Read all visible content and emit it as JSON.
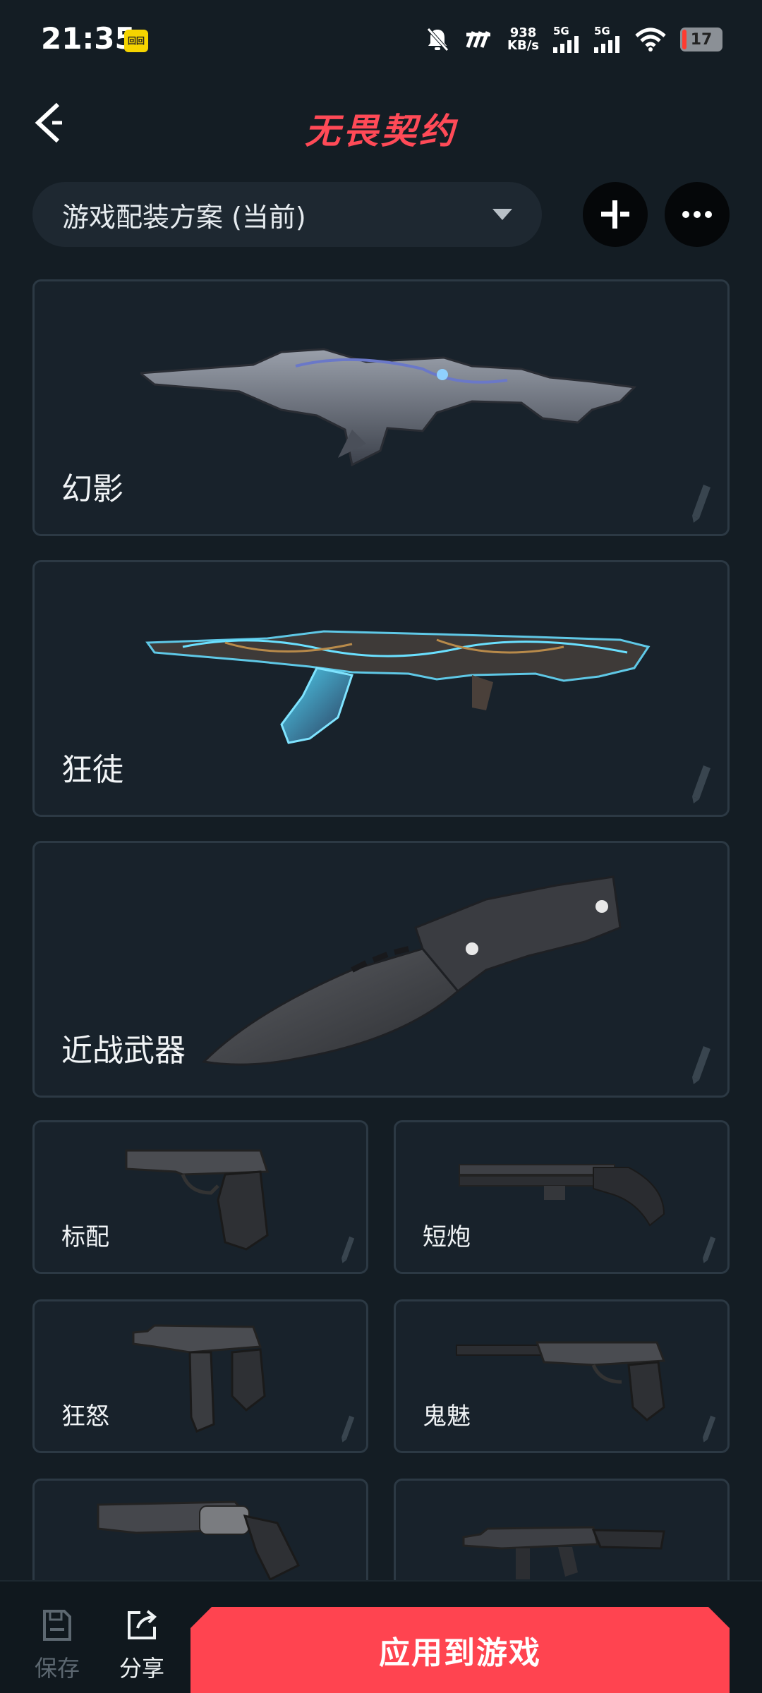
{
  "status_bar": {
    "time": "21:35",
    "notification_badge": "回回",
    "net_speed_value": "938",
    "net_speed_unit": "KB/s",
    "sim1_label": "5G",
    "sim2_label": "5G",
    "battery_level": "17"
  },
  "header": {
    "title": "无畏契约"
  },
  "loadout_selector": {
    "label": "游戏配装方案 (当前)"
  },
  "weapons": {
    "phantom": {
      "label": "幻影"
    },
    "vandal": {
      "label": "狂徒"
    },
    "melee": {
      "label": "近战武器"
    },
    "classic": {
      "label": "标配"
    },
    "shorty": {
      "label": "短炮"
    },
    "frenzy": {
      "label": "狂怒"
    },
    "ghost": {
      "label": "鬼魅"
    },
    "sheriff": {
      "label": ""
    },
    "stinger": {
      "label": ""
    }
  },
  "bottom_bar": {
    "save_label": "保存",
    "share_label": "分享",
    "apply_label": "应用到游戏"
  },
  "colors": {
    "accent": "#ff4450",
    "background": "#141d24",
    "card": "#18222b"
  }
}
